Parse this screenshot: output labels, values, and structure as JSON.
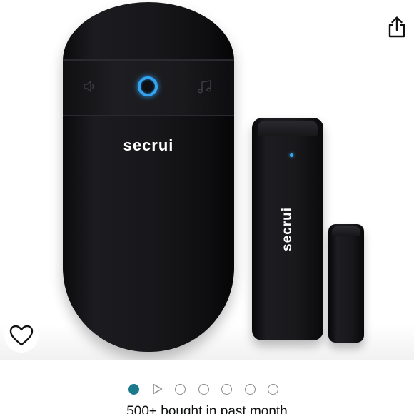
{
  "product": {
    "hub_logo": "secrui",
    "sensor_logo": "secrui"
  },
  "carousel": {
    "total_items": 7,
    "active_index": 0
  },
  "social_proof": "500+ bought in past month",
  "colors": {
    "accent_dot": "#1b7a8b",
    "led_blue": "#35a4f0"
  },
  "icons": {
    "share": "share-icon",
    "favorite": "heart-icon",
    "video": "play-icon"
  }
}
